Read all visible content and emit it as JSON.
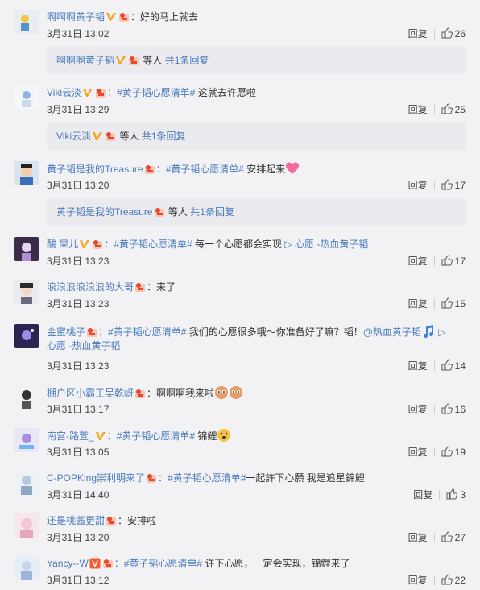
{
  "colors": {
    "link": "#4a7bbd",
    "text": "#333333",
    "meta": "#444444",
    "background": "#f2f2f5",
    "subreply_bg": "#ebebef"
  },
  "comments": [
    {
      "user": "啊啊啊黄子韬",
      "badges": [
        "verified-v-icon",
        "fan-badge-icon"
      ],
      "topic": "",
      "text": "：好的马上就去",
      "time": "3月31日 13:02",
      "reply": "回复",
      "likes": "26",
      "sub": {
        "user": "啊啊啊黄子韬",
        "suffix": "等人",
        "more": "共1条回复"
      }
    },
    {
      "user": "Viki云淡",
      "badges": [
        "verified-v-icon",
        "fan-badge-icon"
      ],
      "topic": "：#黄子韬心愿清单#",
      "text": " 这就去许愿啦",
      "time": "3月31日 13:29",
      "reply": "回复",
      "likes": "25",
      "sub": {
        "user": "Viki云淡",
        "suffix": "等人",
        "more": "共1条回复"
      }
    },
    {
      "user": "黄子韬是我的Treasure",
      "badges": [
        "fan-badge-icon"
      ],
      "topic": "：#黄子韬心愿清单#",
      "text": " 安排起来",
      "time": "3月31日 13:20",
      "reply": "回复",
      "likes": "17",
      "sub": {
        "user": "黄子韬是我的Treasure",
        "suffix": "等人",
        "more": "共1条回复"
      }
    },
    {
      "user": "酸 果儿",
      "badges": [
        "verified-v-icon",
        "fan-badge-icon"
      ],
      "topic": "：#黄子韬心愿清单#",
      "text": " 每一个心愿都会实现 ",
      "link": "▷ 心愿 -热血黄子韬",
      "time": "3月31日 13:23",
      "reply": "回复",
      "likes": "17"
    },
    {
      "user": "浪浪浪浪浪浪的大哥",
      "badges": [
        "fan-badge-icon"
      ],
      "topic": "",
      "text": "：来了",
      "time": "3月31日 13:23",
      "reply": "回复",
      "likes": "15"
    },
    {
      "user": "金蜜桃子",
      "badges": [
        "fan-badge-icon"
      ],
      "topic": "：#黄子韬心愿清单#",
      "text": " 我们的心愿很多哦～你准备好了嘛？韬！",
      "mention": "@热血黄子韬",
      "link2": "▷",
      "line2": "心愿 -热血黄子韬",
      "time": "3月31日 13:23",
      "reply": "回复",
      "likes": "14"
    },
    {
      "user": "棚户区小霸王吴乾岈",
      "badges": [
        "fan-badge-icon"
      ],
      "topic": "",
      "text": "：啊啊啊我来啦",
      "time": "3月31日 13:17",
      "reply": "回复",
      "likes": "16"
    },
    {
      "user": "南宫-路萱_",
      "badges": [
        "verified-v-icon"
      ],
      "topic": "：#黄子韬心愿清单#",
      "text": " 锦鲤",
      "time": "3月31日 13:05",
      "reply": "回复",
      "likes": "19"
    },
    {
      "user": "C-POPKing崇利明来了",
      "badges": [
        "fan-badge-icon"
      ],
      "topic": "：#黄子韬心愿清单#",
      "text": "一起許下心願 我是追星錦鯉",
      "time": "3月31日 14:40",
      "reply": "回复",
      "likes": "3"
    },
    {
      "user": "还是桃酱更甜",
      "badges": [
        "fan-badge-icon"
      ],
      "topic": "",
      "text": "：安排啦",
      "time": "3月31日 13:20",
      "reply": "回复",
      "likes": "27"
    },
    {
      "user": "Yancy--W",
      "badges": [
        "vip-v-icon",
        "fan-badge-icon"
      ],
      "topic": "：#黄子韬心愿清单#",
      "text": " 许下心愿，一定会实现，锦鲤来了",
      "time": "3月31日 13:12",
      "reply": "回复",
      "likes": "22"
    }
  ]
}
